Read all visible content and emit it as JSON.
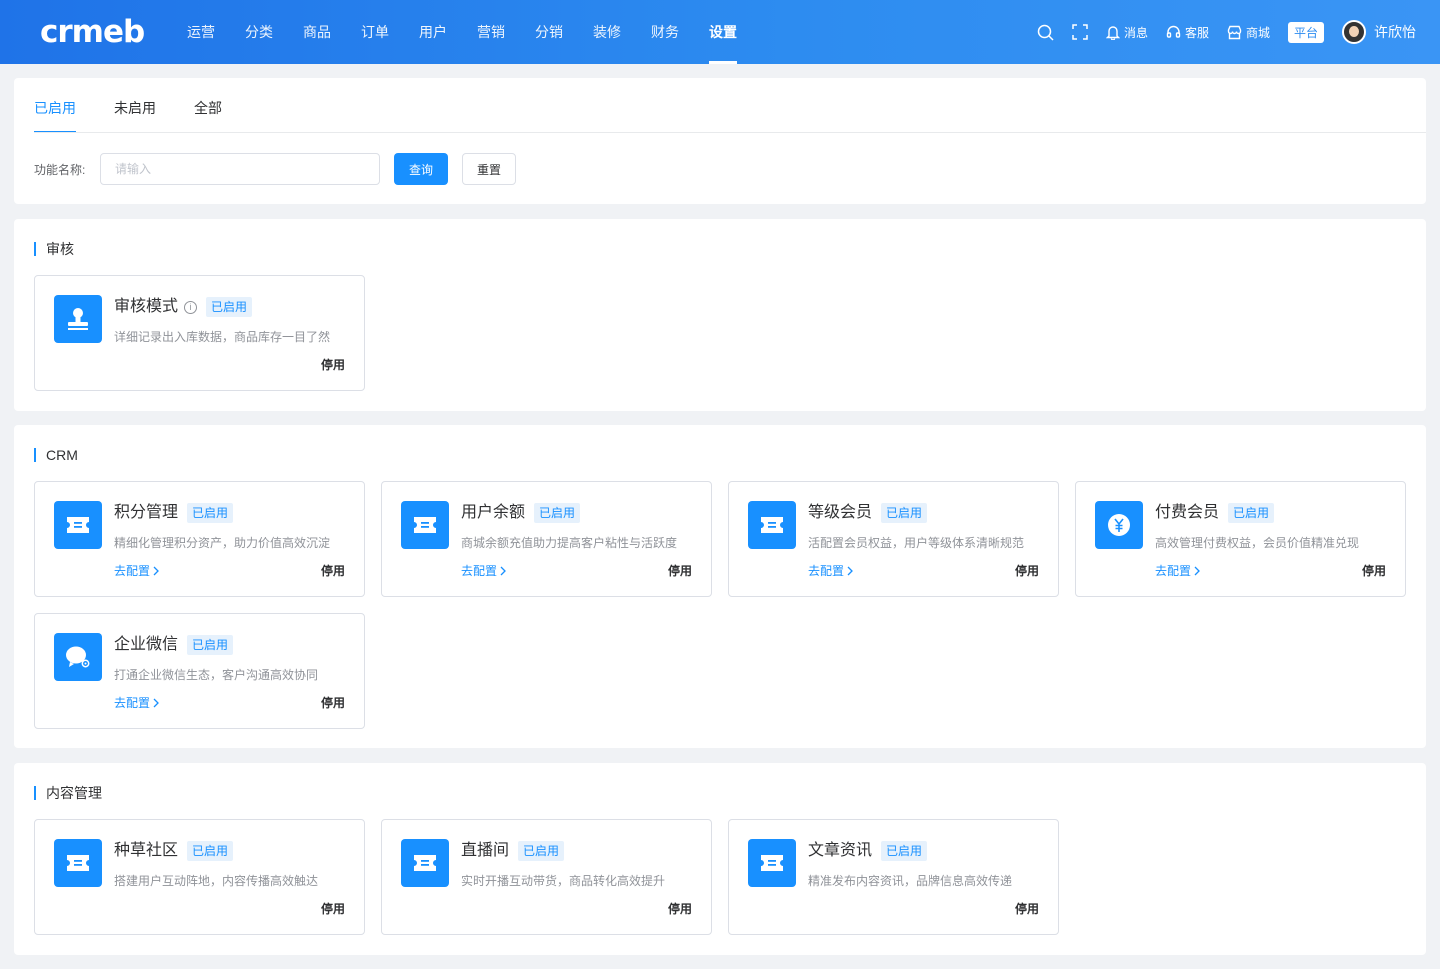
{
  "logo": "crmeb",
  "nav": {
    "items": [
      "运营",
      "分类",
      "商品",
      "订单",
      "用户",
      "营销",
      "分销",
      "装修",
      "财务",
      "设置"
    ],
    "active_index": 9
  },
  "header_tools": {
    "message_label": "消息",
    "service_label": "客服",
    "mall_label": "商城",
    "platform_label": "平台",
    "username": "许欣怡"
  },
  "tabs": {
    "items": [
      "已启用",
      "未启用",
      "全部"
    ],
    "active_index": 0
  },
  "search": {
    "label": "功能名称:",
    "placeholder": "请输入",
    "value": "",
    "query_label": "查询",
    "reset_label": "重置"
  },
  "sections": [
    {
      "title": "审核",
      "cards": [
        {
          "title": "审核模式",
          "info": true,
          "status": "已启用",
          "desc": "详细记录出入库数据，商品库存一目了然",
          "config": "",
          "action": "停用",
          "icon": "stamp-icon"
        }
      ]
    },
    {
      "title": "CRM",
      "cards": [
        {
          "title": "积分管理",
          "status": "已启用",
          "desc": "精细化管理积分资产，助力价值高效沉淀",
          "config": "去配置",
          "action": "停用",
          "icon": "ticket-icon"
        },
        {
          "title": "用户余额",
          "status": "已启用",
          "desc": "商城余额充值助力提高客户粘性与活跃度",
          "config": "去配置",
          "action": "停用",
          "icon": "ticket-icon"
        },
        {
          "title": "等级会员",
          "status": "已启用",
          "desc": "活配置会员权益，用户等级体系清晰规范",
          "config": "去配置",
          "action": "停用",
          "icon": "ticket-icon"
        },
        {
          "title": "付费会员",
          "status": "已启用",
          "desc": "高效管理付费权益，会员价值精准兑现",
          "config": "去配置",
          "action": "停用",
          "icon": "yen-icon"
        },
        {
          "title": "企业微信",
          "status": "已启用",
          "desc": "打通企业微信生态，客户沟通高效协同",
          "config": "去配置",
          "action": "停用",
          "icon": "wechat-work-icon"
        }
      ]
    },
    {
      "title": "内容管理",
      "cards": [
        {
          "title": "种草社区",
          "status": "已启用",
          "desc": "搭建用户互动阵地，内容传播高效触达",
          "config": "",
          "action": "停用",
          "icon": "ticket-icon"
        },
        {
          "title": "直播间",
          "status": "已启用",
          "desc": "实时开播互动带货，商品转化高效提升",
          "config": "",
          "action": "停用",
          "icon": "ticket-icon"
        },
        {
          "title": "文章资讯",
          "status": "已启用",
          "desc": "精准发布内容资讯，品牌信息高效传递",
          "config": "",
          "action": "停用",
          "icon": "ticket-icon"
        }
      ]
    }
  ],
  "colors": {
    "primary": "#1890ff",
    "header_start": "#1f73e8",
    "header_end": "#3a95f5"
  }
}
